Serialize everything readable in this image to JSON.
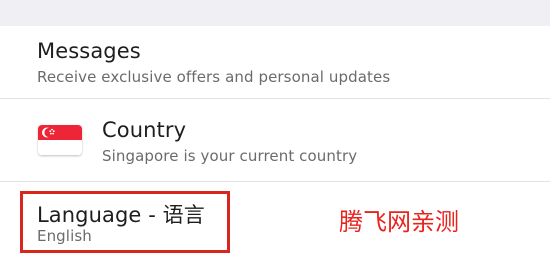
{
  "settings": {
    "messages": {
      "title": "Messages",
      "subtitle": "Receive exclusive offers and personal updates"
    },
    "country": {
      "flag_icon": "singapore-flag-icon",
      "title": "Country",
      "subtitle": "Singapore is your current country"
    },
    "language": {
      "title": "Language - 语言",
      "subtitle": "English"
    }
  },
  "annotation": {
    "text": "腾飞网亲测",
    "highlight_color": "#d9261c"
  }
}
